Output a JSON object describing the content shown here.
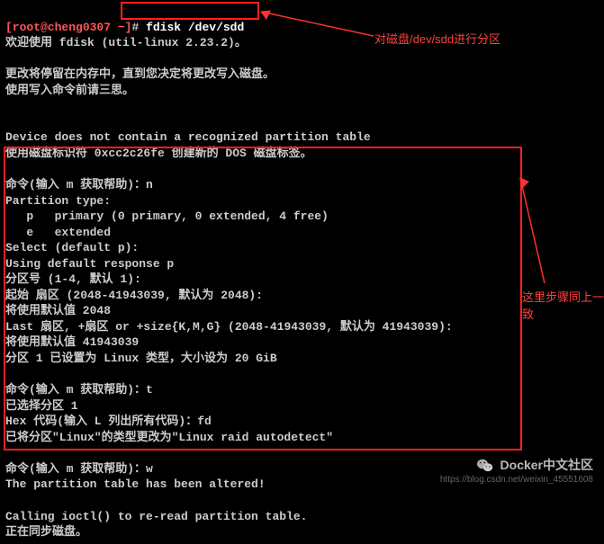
{
  "prompt": {
    "user_host": "[root@cheng0307 ~]",
    "symbol": "#",
    "command": "fdisk /dev/sdd"
  },
  "intro": {
    "l1": "欢迎使用 fdisk (util-linux 2.23.2)。",
    "l2": "",
    "l3": "更改将停留在内存中，直到您决定将更改写入磁盘。",
    "l4": "使用写入命令前请三思。",
    "l5": "",
    "l6": "",
    "l7": "Device does not contain a recognized partition table",
    "l8": "使用磁盘标识符 0xcc2c26fe 创建新的 DOS 磁盘标签。"
  },
  "session": {
    "s1": "命令(输入 m 获取帮助)：n",
    "s2": "Partition type:",
    "s3": "   p   primary (0 primary, 0 extended, 4 free)",
    "s4": "   e   extended",
    "s5": "Select (default p):",
    "s6": "Using default response p",
    "s7": "分区号 (1-4, 默认 1):",
    "s8": "起始 扇区 (2048-41943039, 默认为 2048):",
    "s9": "将使用默认值 2048",
    "s10": "Last 扇区, +扇区 or +size{K,M,G} (2048-41943039, 默认为 41943039):",
    "s11": "将使用默认值 41943039",
    "s12": "分区 1 已设置为 Linux 类型，大小设为 20 GiB",
    "s13": "",
    "s14": "命令(输入 m 获取帮助)：t",
    "s15": "已选择分区 1",
    "s16": "Hex 代码(输入 L 列出所有代码)：fd",
    "s17": "已将分区\"Linux\"的类型更改为\"Linux raid autodetect\"",
    "s18": "",
    "s19": "命令(输入 m 获取帮助)：w",
    "s20": "The partition table has been altered!"
  },
  "tail": {
    "t1": "Calling ioctl() to re-read partition table.",
    "t2": "正在同步磁盘。"
  },
  "annotations": {
    "a1": "对磁盘/dev/sdd进行分区",
    "a2": "这里步骤同上一致"
  },
  "watermark": {
    "brand": "Docker中文社区",
    "url": "https://blog.csdn.net/weixin_45551608"
  }
}
